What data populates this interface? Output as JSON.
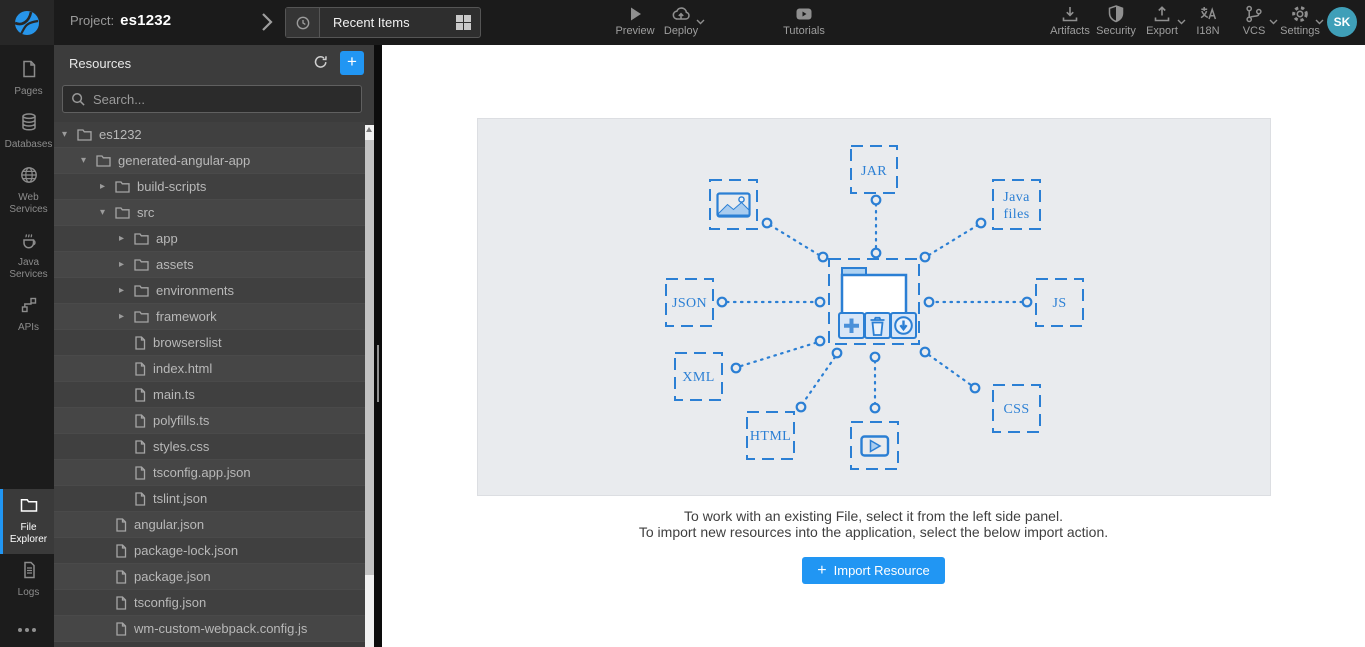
{
  "topbar": {
    "project_label": "Project:",
    "project_name": "es1232",
    "recent": {
      "label": "Recent Items"
    },
    "center_actions": [
      {
        "label": "Preview"
      },
      {
        "label": "Deploy"
      },
      {
        "label": "Tutorials"
      }
    ],
    "right_actions": [
      {
        "label": "Artifacts"
      },
      {
        "label": "Security"
      },
      {
        "label": "Export"
      },
      {
        "label": "I18N"
      },
      {
        "label": "VCS"
      },
      {
        "label": "Settings"
      }
    ],
    "avatar_initials": "SK"
  },
  "left_nav": {
    "items": [
      {
        "label": "Pages"
      },
      {
        "label": "Databases"
      },
      {
        "label": "Web Services"
      },
      {
        "label": "Java Services"
      },
      {
        "label": "APIs"
      },
      {
        "label": "File Explorer",
        "active": true
      },
      {
        "label": "Logs"
      }
    ]
  },
  "resources_panel": {
    "title": "Resources",
    "add_icon": "+",
    "search_placeholder": "Search...",
    "tree": [
      {
        "arrow": "▾",
        "label": "es1232",
        "type": "folder",
        "level": 0
      },
      {
        "arrow": "▾",
        "label": "generated-angular-app",
        "type": "folder",
        "level": 1
      },
      {
        "arrow": "▸",
        "label": "build-scripts",
        "type": "folder",
        "level": 2
      },
      {
        "arrow": "▾",
        "label": "src",
        "type": "folder",
        "level": 2
      },
      {
        "arrow": "▸",
        "label": "app",
        "type": "folder",
        "level": 3
      },
      {
        "arrow": "▸",
        "label": "assets",
        "type": "folder",
        "level": 3
      },
      {
        "arrow": "▸",
        "label": "environments",
        "type": "folder",
        "level": 3
      },
      {
        "arrow": "▸",
        "label": "framework",
        "type": "folder",
        "level": 3
      },
      {
        "arrow": "",
        "label": "browserslist",
        "type": "file",
        "level": 3
      },
      {
        "arrow": "",
        "label": "index.html",
        "type": "file",
        "level": 3
      },
      {
        "arrow": "",
        "label": "main.ts",
        "type": "file",
        "level": 3
      },
      {
        "arrow": "",
        "label": "polyfills.ts",
        "type": "file",
        "level": 3
      },
      {
        "arrow": "",
        "label": "styles.css",
        "type": "file",
        "level": 3
      },
      {
        "arrow": "",
        "label": "tsconfig.app.json",
        "type": "file",
        "level": 3
      },
      {
        "arrow": "",
        "label": "tslint.json",
        "type": "file",
        "level": 3
      },
      {
        "arrow": "",
        "label": "angular.json",
        "type": "file",
        "level": 2
      },
      {
        "arrow": "",
        "label": "package-lock.json",
        "type": "file",
        "level": 2
      },
      {
        "arrow": "",
        "label": "package.json",
        "type": "file",
        "level": 2
      },
      {
        "arrow": "",
        "label": "tsconfig.json",
        "type": "file",
        "level": 2
      },
      {
        "arrow": "",
        "label": "wm-custom-webpack.config.js",
        "type": "file",
        "level": 2
      }
    ]
  },
  "illustration": {
    "nodes": {
      "jar": "JAR",
      "java_files_line1": "Java",
      "java_files_line2": "files",
      "json": "JSON",
      "js": "JS",
      "xml": "XML",
      "html": "HTML",
      "css": "CSS"
    }
  },
  "main": {
    "instruction_line1": "To work with an existing File, select it from the left side panel.",
    "instruction_line2": "To import new resources into the application, select the below import action.",
    "import_button": {
      "icon": "+",
      "label": "Import Resource"
    }
  },
  "colors": {
    "accent_blue": "#2196f3",
    "illustration_blue": "#2b7fd4",
    "avatar_teal": "#3f9fb8",
    "illustration_panel_bg": "#e9ebee",
    "topbar_bg": "#1b1b1b",
    "sidebar_bg": "#3c3c3c"
  }
}
